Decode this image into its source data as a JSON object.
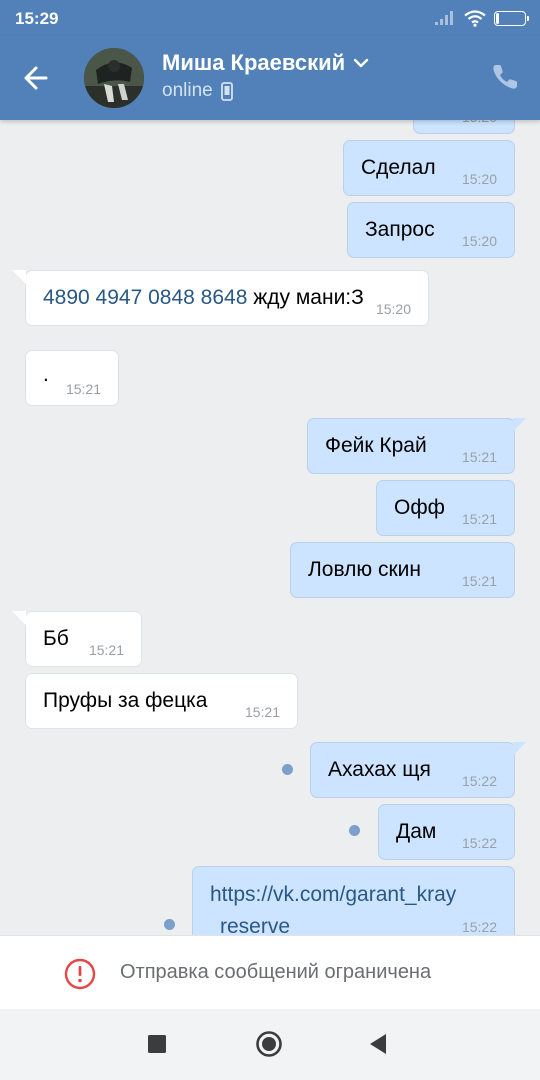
{
  "status_bar": {
    "time": "15:29",
    "battery": "11",
    "battery_level_percent": 11
  },
  "header": {
    "contact_name": "Миша Краевский",
    "status": "online"
  },
  "colors": {
    "header": "#5181b8",
    "outgoing_bubble": "#cce4ff",
    "incoming_bubble": "#ffffff",
    "link": "#2a5885",
    "alert": "#e64646"
  },
  "messages": [
    {
      "direction": "out",
      "text": "Сделал",
      "time": "15:20"
    },
    {
      "direction": "out",
      "text": "Запрос",
      "time": "15:20"
    },
    {
      "direction": "in",
      "card_number": "4890 4947 0848 8648",
      "text": "жду мани:З",
      "time": "15:20"
    },
    {
      "direction": "in",
      "text": ".",
      "time": "15:21"
    },
    {
      "direction": "out",
      "text": "Фейк Край",
      "time": "15:21"
    },
    {
      "direction": "out",
      "text": "Офф",
      "time": "15:21"
    },
    {
      "direction": "out",
      "text": "Ловлю скин",
      "time": "15:21"
    },
    {
      "direction": "in",
      "text": "Бб",
      "time": "15:21"
    },
    {
      "direction": "in",
      "text": "Пруфы за фецка",
      "time": "15:21"
    },
    {
      "direction": "out",
      "text": "Ахахах щя",
      "time": "15:22",
      "unread": true
    },
    {
      "direction": "out",
      "text": "Дам",
      "time": "15:22",
      "unread": true
    },
    {
      "direction": "out",
      "text_line1": "https://vk.com/garant_kray",
      "text_line2": "reserve",
      "time": "15:22",
      "unread": true
    }
  ],
  "restriction": {
    "text": "Отправка сообщений ограничена",
    "icon": "alert-circle-icon"
  },
  "nav": {
    "icons": [
      "recent-apps-icon",
      "home-icon",
      "back-icon"
    ]
  }
}
